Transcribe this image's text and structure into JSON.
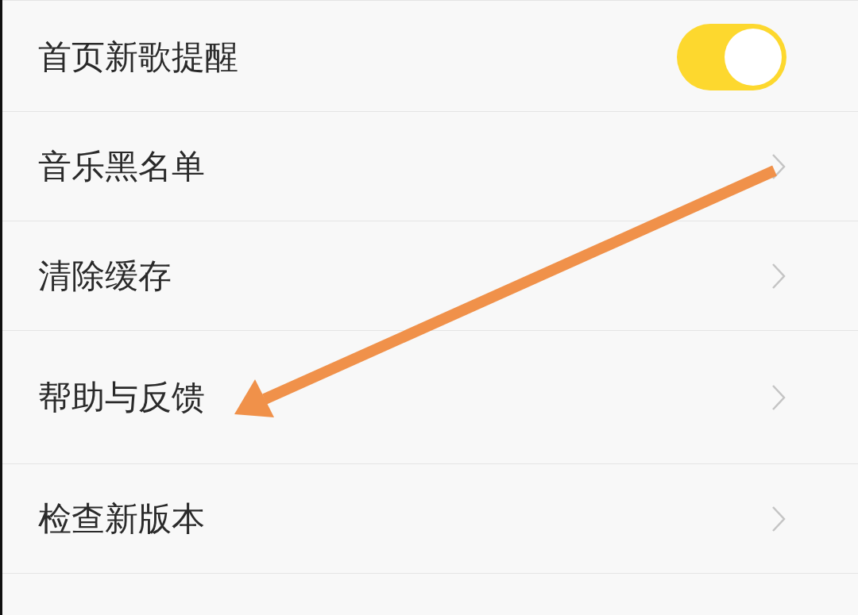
{
  "settings": [
    {
      "kind": "toggle",
      "label": "首页新歌提醒",
      "on": true
    },
    {
      "kind": "link",
      "label": "音乐黑名单"
    },
    {
      "kind": "link",
      "label": "清除缓存"
    },
    {
      "kind": "link",
      "label": "帮助与反馈",
      "tall": true
    },
    {
      "kind": "link",
      "label": "检查新版本"
    },
    {
      "kind": "blank"
    }
  ]
}
